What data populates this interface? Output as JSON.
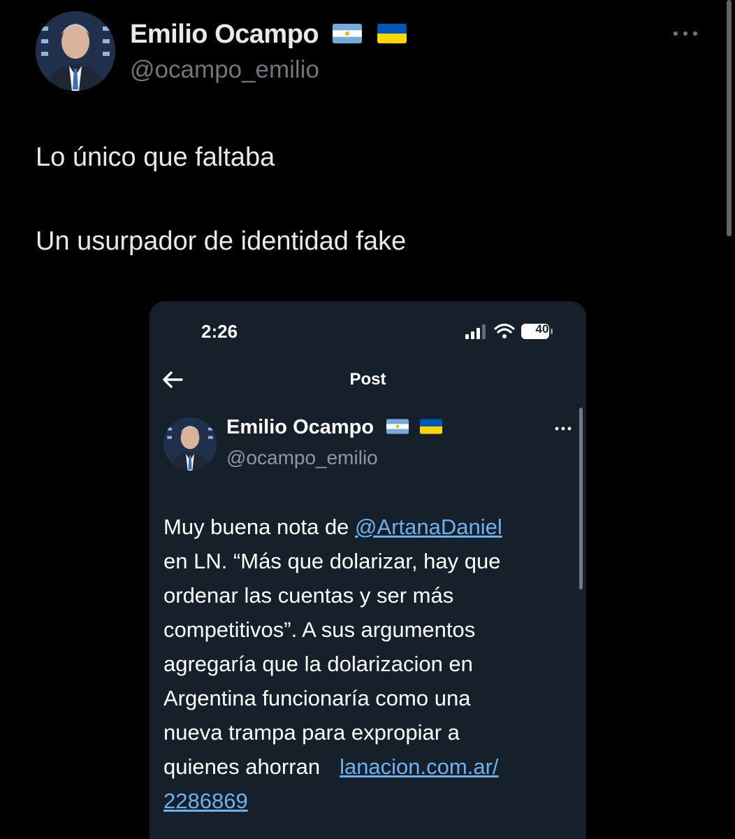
{
  "outer_post": {
    "author": {
      "name": "Emilio Ocampo",
      "handle": "@ocampo_emilio",
      "avatar": "person-avatar",
      "flags": [
        "argentina-flag",
        "ukraine-flag"
      ]
    },
    "more_icon": "more-horizontal-icon",
    "text_lines": [
      "Lo único que faltaba",
      "Un usurpador de identidad fake"
    ]
  },
  "embedded_screenshot": {
    "status_bar": {
      "time": "2:26",
      "battery": "40",
      "icons": [
        "signal-icon",
        "wifi-icon",
        "battery-icon"
      ]
    },
    "nav": {
      "back_icon": "back-arrow-icon",
      "title": "Post"
    },
    "post": {
      "author": {
        "name": "Emilio Ocampo",
        "handle": "@ocampo_emilio",
        "flags": [
          "argentina-flag",
          "ukraine-flag"
        ]
      },
      "more_icon": "more-horizontal-icon",
      "body": {
        "line1_prefix": "Muy buena nota de ",
        "mention": "@ArtanaDaniel",
        "line2": "en LN. “Más que dolarizar, hay que",
        "line3": "ordenar las cuentas y ser más",
        "line4": "competitivos”. A sus argumentos",
        "line5": "agregaría que la dolarizacion en",
        "line6": "Argentina funcionaría como una",
        "line7": "nueva trampa para expropiar a",
        "line8_prefix": "quienes ahorran",
        "link_part1": "lanacion.com.ar/",
        "link_part2": "2286869"
      }
    }
  },
  "colors": {
    "background": "#000000",
    "phone_background": "#15202b",
    "text_primary": "#e7e9ea",
    "text_secondary": "#71767b",
    "link": "#6fb0ef"
  }
}
